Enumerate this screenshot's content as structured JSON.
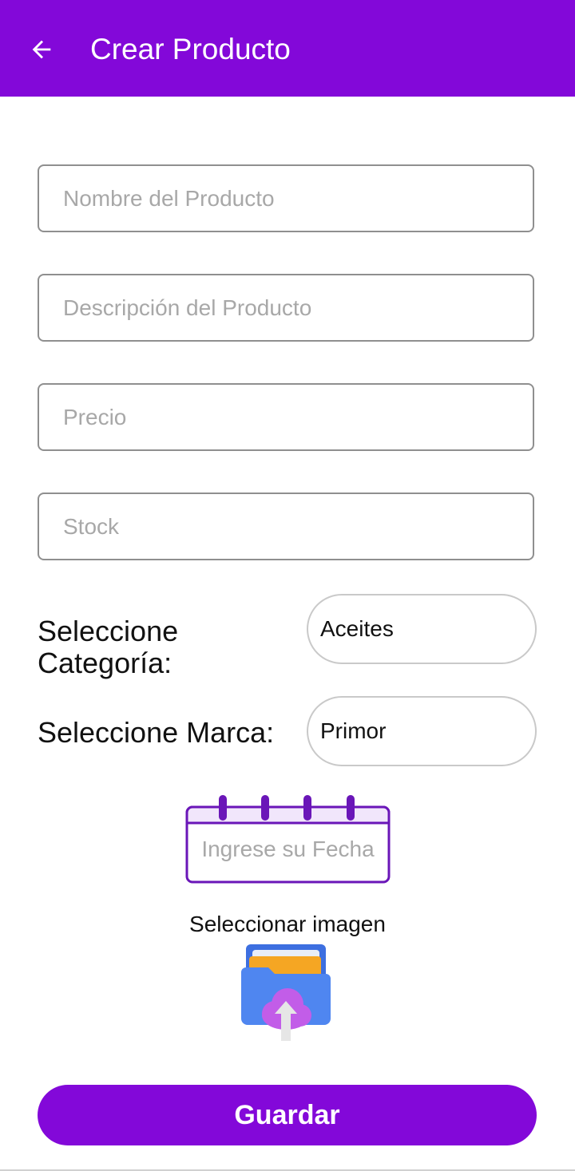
{
  "header": {
    "title": "Crear Producto",
    "back_icon": "arrow-left-icon",
    "color": "#8308d9"
  },
  "form": {
    "name_placeholder": "Nombre del Producto",
    "name_value": "",
    "description_placeholder": "Descripción del Producto",
    "description_value": "",
    "price_placeholder": "Precio",
    "price_value": "",
    "stock_placeholder": "Stock",
    "stock_value": "",
    "category_label": "Seleccione Categoría:",
    "category_selected": "Aceites",
    "brand_label": "Seleccione Marca:",
    "brand_selected": "Primor",
    "date_placeholder": "Ingrese su Fecha",
    "calendar_icon": "calendar-icon",
    "image_label": "Seleccionar imagen",
    "image_icon": "folder-upload-icon"
  },
  "actions": {
    "save_label": "Guardar"
  }
}
